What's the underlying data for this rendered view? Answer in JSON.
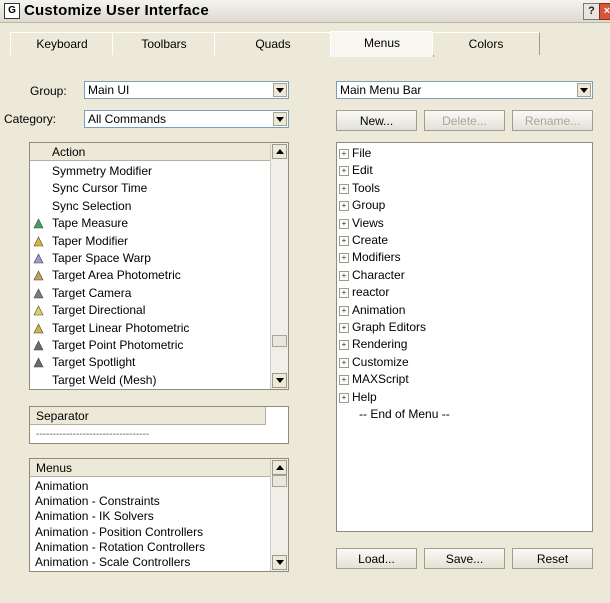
{
  "window": {
    "title": "Customize User Interface",
    "app_icon": "G",
    "help": "?",
    "close": "×"
  },
  "tabs": [
    {
      "label": "Keyboard"
    },
    {
      "label": "Toolbars"
    },
    {
      "label": "Quads"
    },
    {
      "label": "Menus"
    },
    {
      "label": "Colors"
    }
  ],
  "active_tab": "Menus",
  "group": {
    "label": "Group:",
    "value": "Main UI"
  },
  "category": {
    "label": "Category:",
    "value": "All Commands"
  },
  "action_list": {
    "header": "Action",
    "items": [
      {
        "label": "Symmetry Modifier",
        "icon": ""
      },
      {
        "label": "Sync Cursor Time",
        "icon": ""
      },
      {
        "label": "Sync Selection",
        "icon": ""
      },
      {
        "label": "Tape Measure",
        "icon": "tape-measure-icon"
      },
      {
        "label": "Taper Modifier",
        "icon": "taper-modifier-icon"
      },
      {
        "label": "Taper Space Warp",
        "icon": "taper-space-warp-icon"
      },
      {
        "label": "Target Area Photometric",
        "icon": "target-area-photometric-icon"
      },
      {
        "label": "Target Camera",
        "icon": "target-camera-icon"
      },
      {
        "label": "Target Directional",
        "icon": "target-directional-icon"
      },
      {
        "label": "Target Linear Photometric",
        "icon": "target-linear-photometric-icon"
      },
      {
        "label": "Target Point Photometric",
        "icon": "target-point-photometric-icon"
      },
      {
        "label": "Target Spotlight",
        "icon": "target-spotlight-icon"
      },
      {
        "label": "Target Weld (Mesh)",
        "icon": ""
      }
    ]
  },
  "separator": {
    "header": "Separator",
    "value": "----------------------------------"
  },
  "menus_list": {
    "header": "Menus",
    "items": [
      {
        "label": "Animation"
      },
      {
        "label": "Animation - Constraints"
      },
      {
        "label": "Animation - IK Solvers"
      },
      {
        "label": "Animation - Position Controllers"
      },
      {
        "label": "Animation - Rotation Controllers"
      },
      {
        "label": "Animation - Scale Controllers"
      }
    ]
  },
  "menu_bar_select": {
    "value": "Main Menu Bar"
  },
  "buttons": {
    "new": "New...",
    "delete": "Delete...",
    "rename": "Rename...",
    "load": "Load...",
    "save": "Save...",
    "reset": "Reset"
  },
  "menu_tree": {
    "items": [
      {
        "label": "File"
      },
      {
        "label": "Edit"
      },
      {
        "label": "Tools"
      },
      {
        "label": "Group"
      },
      {
        "label": "Views"
      },
      {
        "label": "Create"
      },
      {
        "label": "Modifiers"
      },
      {
        "label": "Character"
      },
      {
        "label": "reactor"
      },
      {
        "label": "Animation"
      },
      {
        "label": "Graph Editors"
      },
      {
        "label": "Rendering"
      },
      {
        "label": "Customize"
      },
      {
        "label": "MAXScript"
      },
      {
        "label": "Help"
      }
    ],
    "end_label": "-- End of Menu --"
  }
}
